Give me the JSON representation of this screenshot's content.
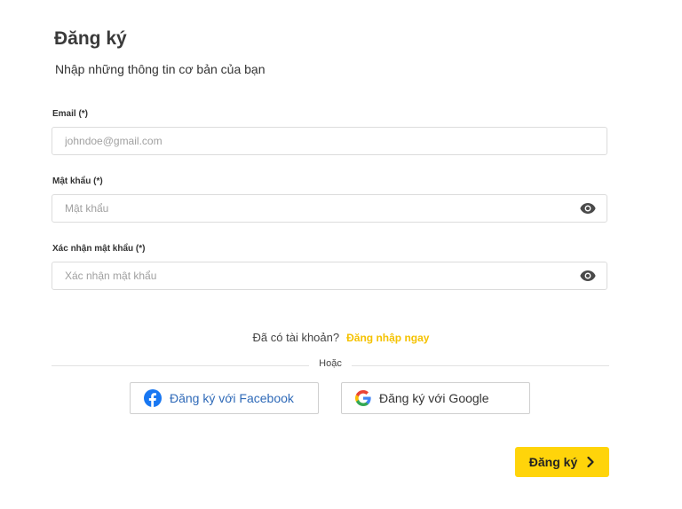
{
  "header": {
    "title": "Đăng ký",
    "subtitle": "Nhập những thông tin cơ bản của bạn"
  },
  "form": {
    "email": {
      "label": "Email (*)",
      "placeholder": "johndoe@gmail.com",
      "value": ""
    },
    "password": {
      "label": "Mật khẩu (*)",
      "placeholder": "Mật khẩu",
      "value": "",
      "icon": "eye-icon"
    },
    "confirm_password": {
      "label": "Xác nhận mật khẩu (*)",
      "placeholder": "Xác nhận mật khẩu",
      "value": "",
      "icon": "eye-icon"
    }
  },
  "login_prompt": {
    "question": "Đã có tài khoản?",
    "link": "Đăng nhập ngay"
  },
  "separator": {
    "text": "Hoặc"
  },
  "social": {
    "facebook": {
      "label": "Đăng ký với Facebook",
      "icon": "facebook-icon"
    },
    "google": {
      "label": "Đăng ký với Google",
      "icon": "google-icon"
    }
  },
  "submit": {
    "label": "Đăng ký",
    "icon": "chevron-right-icon"
  },
  "colors": {
    "accent": "#ffd40a",
    "link": "#f5c200",
    "facebook": "#1877f2",
    "facebook_text": "#2f6ab8"
  }
}
